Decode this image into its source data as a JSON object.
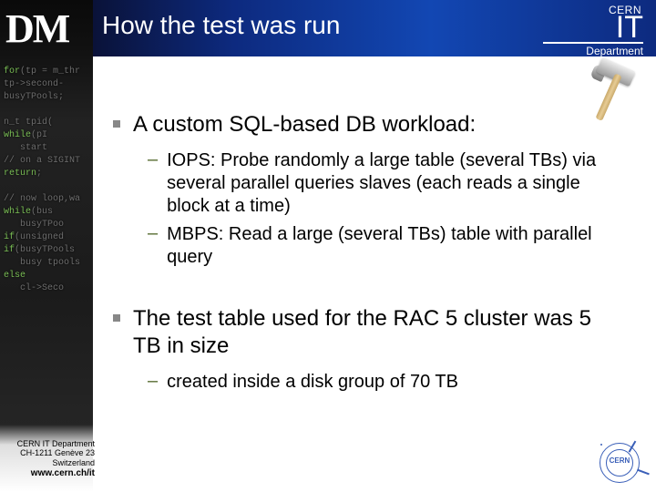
{
  "logo": {
    "text": "DM"
  },
  "header": {
    "title": "How the test was run",
    "org_top": "CERN",
    "org_main": "IT",
    "org_sub": "Department"
  },
  "bullets": [
    {
      "text": "A custom SQL-based DB workload:",
      "sub": [
        {
          "text": "IOPS: Probe randomly a large table (several TBs) via several parallel queries slaves (each reads a single block at a time)"
        },
        {
          "text": "MBPS: Read a large (several TBs) table with parallel query"
        }
      ]
    },
    {
      "text": "The test table used for the RAC 5 cluster was 5 TB in size",
      "sub": [
        {
          "text": "created inside a disk group of 70 TB"
        }
      ]
    }
  ],
  "footer": {
    "line1": "CERN IT Department",
    "line2": "CH-1211 Genève 23",
    "line3": "Switzerland",
    "url": "www.cern.ch/it"
  },
  "seal": {
    "label": "CERN"
  },
  "decoration": {
    "hammer_name": "hammer-icon"
  }
}
